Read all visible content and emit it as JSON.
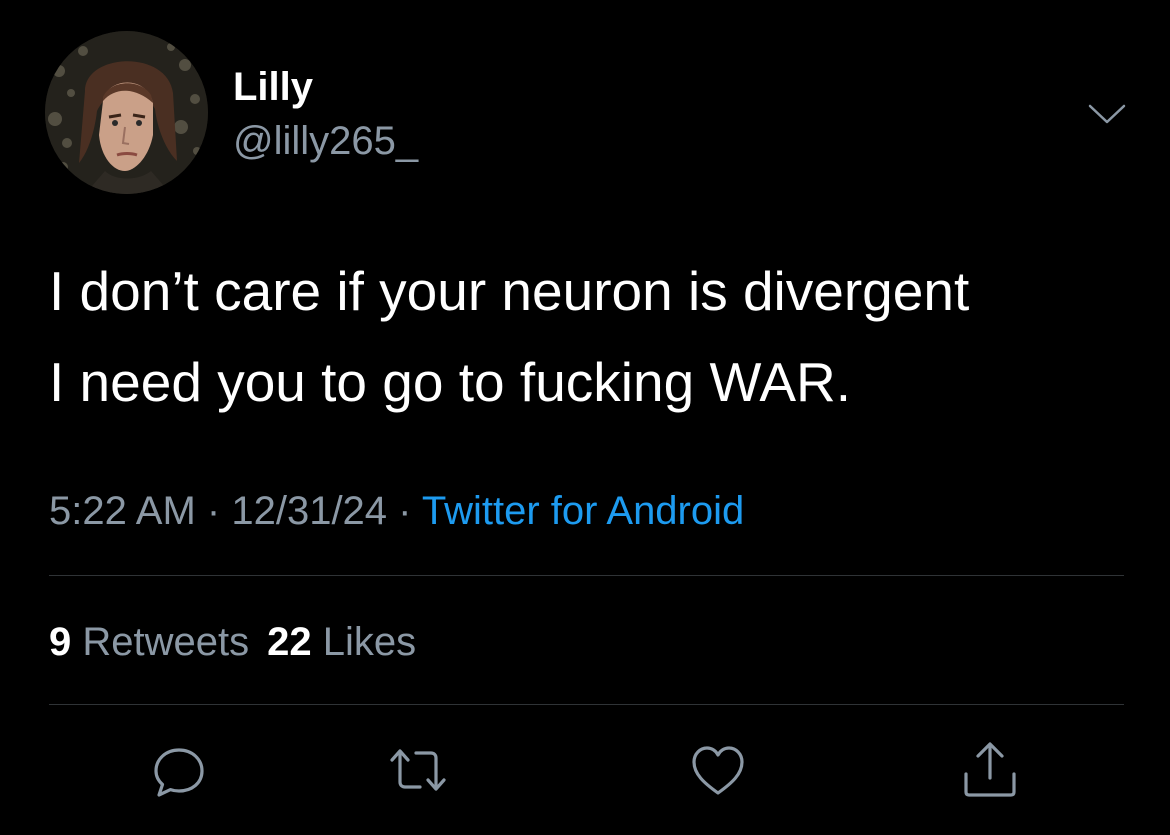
{
  "user": {
    "display_name": "Lilly",
    "handle": "@lilly265_",
    "avatar_icon": "profile-avatar"
  },
  "tweet": {
    "lines": [
      "I don’t care if your neuron is divergent",
      "I need you to go to fucking WAR."
    ]
  },
  "meta": {
    "time": "5:22 AM",
    "separator": "·",
    "date": "12/31/24",
    "source": "Twitter for Android"
  },
  "stats": {
    "retweets_count": "9",
    "retweets_label": "Retweets",
    "likes_count": "22",
    "likes_label": "Likes"
  },
  "actions": {
    "reply_icon": "reply-icon",
    "retweet_icon": "retweet-icon",
    "like_icon": "heart-icon",
    "share_icon": "share-icon",
    "menu_icon": "chevron-down-icon"
  },
  "colors": {
    "background": "#000000",
    "text_primary": "#ffffff",
    "text_secondary": "#8b98a5",
    "link": "#1d9bf0",
    "divider": "#2f3336"
  }
}
